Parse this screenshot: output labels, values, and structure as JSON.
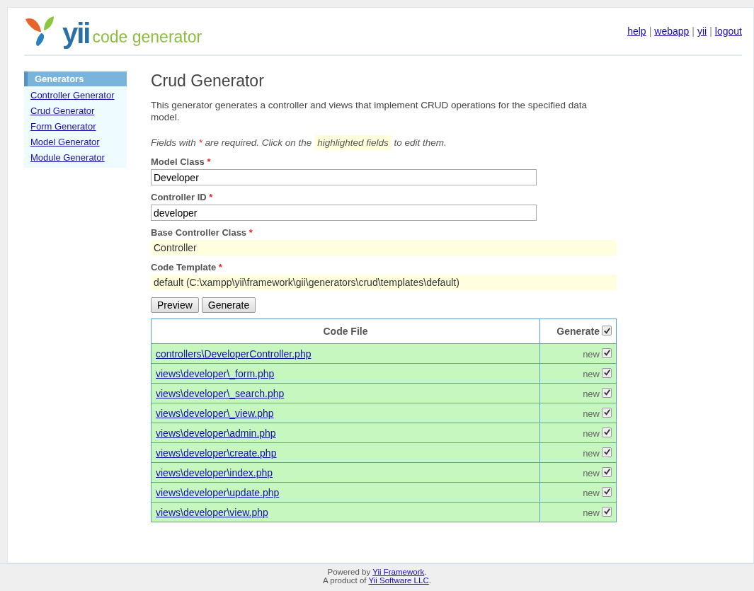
{
  "header": {
    "logo_word": "yii",
    "logo_subtitle": "code generator",
    "links": [
      "help",
      "webapp",
      "yii",
      "logout"
    ],
    "separator": "|"
  },
  "sidebar": {
    "title": "Generators",
    "items": [
      {
        "label": "Controller Generator"
      },
      {
        "label": "Crud Generator"
      },
      {
        "label": "Form Generator"
      },
      {
        "label": "Model Generator"
      },
      {
        "label": "Module Generator"
      }
    ]
  },
  "main": {
    "title": "Crud Generator",
    "description": "This generator generates a controller and views that implement CRUD operations for the specified data model.",
    "hint": [
      {
        "kind": "plain",
        "text": "Fields with "
      },
      {
        "kind": "required",
        "text": "*"
      },
      {
        "kind": "plain",
        "text": " are required. Click on the "
      },
      {
        "kind": "highlight",
        "text": "highlighted fields"
      },
      {
        "kind": "plain",
        "text": " to edit them."
      }
    ],
    "fields": [
      {
        "kind": "input",
        "label": "Model Class",
        "required_mark": "*",
        "value": "Developer"
      },
      {
        "kind": "input",
        "label": "Controller ID",
        "required_mark": "*",
        "value": "developer"
      },
      {
        "kind": "sticky",
        "label": "Base Controller Class",
        "required_mark": "*",
        "value": "Controller"
      },
      {
        "kind": "sticky",
        "label": "Code Template",
        "required_mark": "*",
        "value": "default (C:\\xampp\\yii\\framework\\gii\\generators\\crud\\templates\\default)"
      }
    ],
    "buttons": [
      "Preview",
      "Generate"
    ],
    "table": {
      "columns": [
        "Code File",
        "Generate"
      ],
      "header_checked": true,
      "rows": [
        {
          "file": "controllers\\DeveloperController.php",
          "status": "new",
          "checked": true
        },
        {
          "file": "views\\developer\\_form.php",
          "status": "new",
          "checked": true
        },
        {
          "file": "views\\developer\\_search.php",
          "status": "new",
          "checked": true
        },
        {
          "file": "views\\developer\\_view.php",
          "status": "new",
          "checked": true
        },
        {
          "file": "views\\developer\\admin.php",
          "status": "new",
          "checked": true
        },
        {
          "file": "views\\developer\\create.php",
          "status": "new",
          "checked": true
        },
        {
          "file": "views\\developer\\index.php",
          "status": "new",
          "checked": true
        },
        {
          "file": "views\\developer\\update.php",
          "status": "new",
          "checked": true
        },
        {
          "file": "views\\developer\\view.php",
          "status": "new",
          "checked": true
        }
      ]
    }
  },
  "footer": {
    "lines": [
      {
        "before": "Powered by ",
        "link": "Yii Framework",
        "after": "."
      },
      {
        "before": "A product of ",
        "link": "Yii Software LLC",
        "after": "."
      }
    ]
  }
}
